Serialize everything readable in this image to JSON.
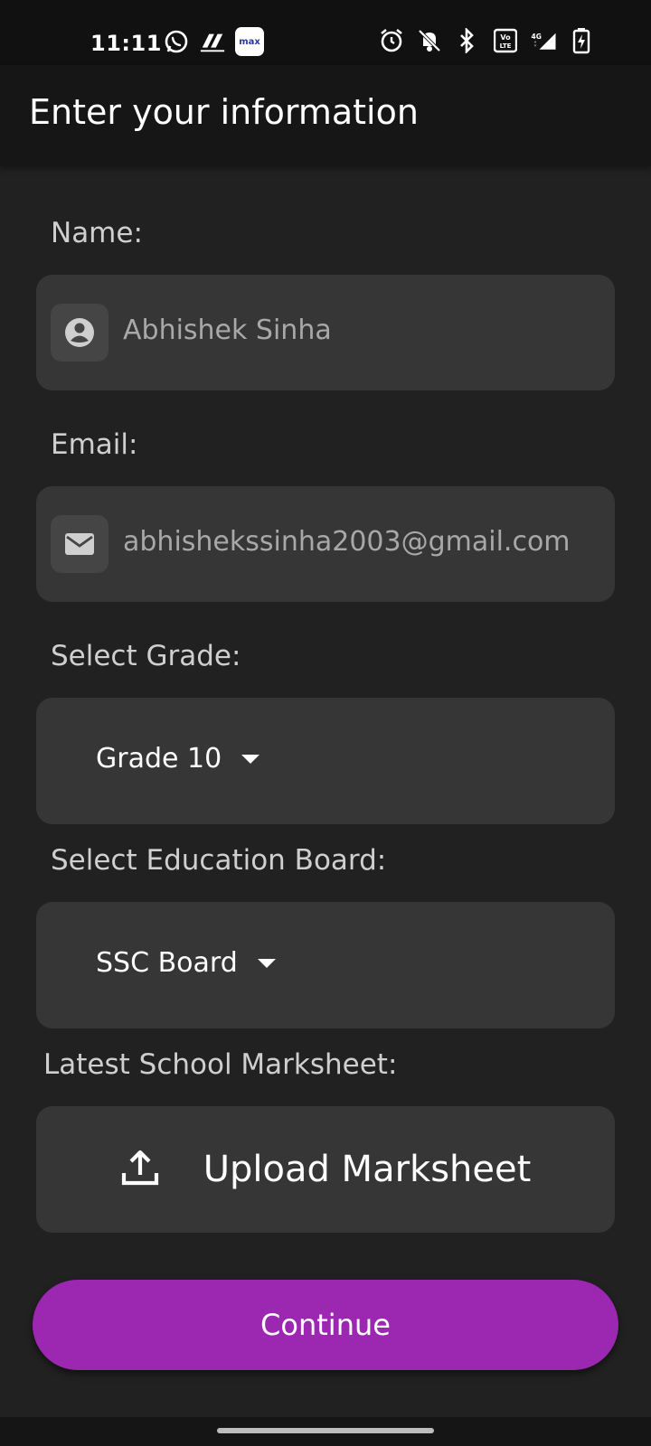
{
  "status_bar": {
    "time": "11:11",
    "left_icons": [
      "whatsapp-icon",
      "app-icon",
      "max-badge"
    ],
    "max_label": "max",
    "right_icons": [
      "alarm-icon",
      "bell-off-icon",
      "bluetooth-icon",
      "volte-icon",
      "signal-icon",
      "battery-charging-icon"
    ],
    "network_label": "4G"
  },
  "app_bar": {
    "title": "Enter your information"
  },
  "form": {
    "name_label": "Name:",
    "name_value": "Abhishek Sinha",
    "email_label": "Email:",
    "email_value": "abhishekssinha2003@gmail.com",
    "grade_label": "Select Grade:",
    "grade_value": "Grade 10",
    "board_label": "Select Education Board:",
    "board_value": "SSC Board",
    "marksheet_label": "Latest School Marksheet:",
    "upload_label": "Upload Marksheet"
  },
  "actions": {
    "continue_label": "Continue"
  },
  "colors": {
    "accent": "#9c27b0",
    "background": "#212121",
    "field_background": "#363636"
  }
}
